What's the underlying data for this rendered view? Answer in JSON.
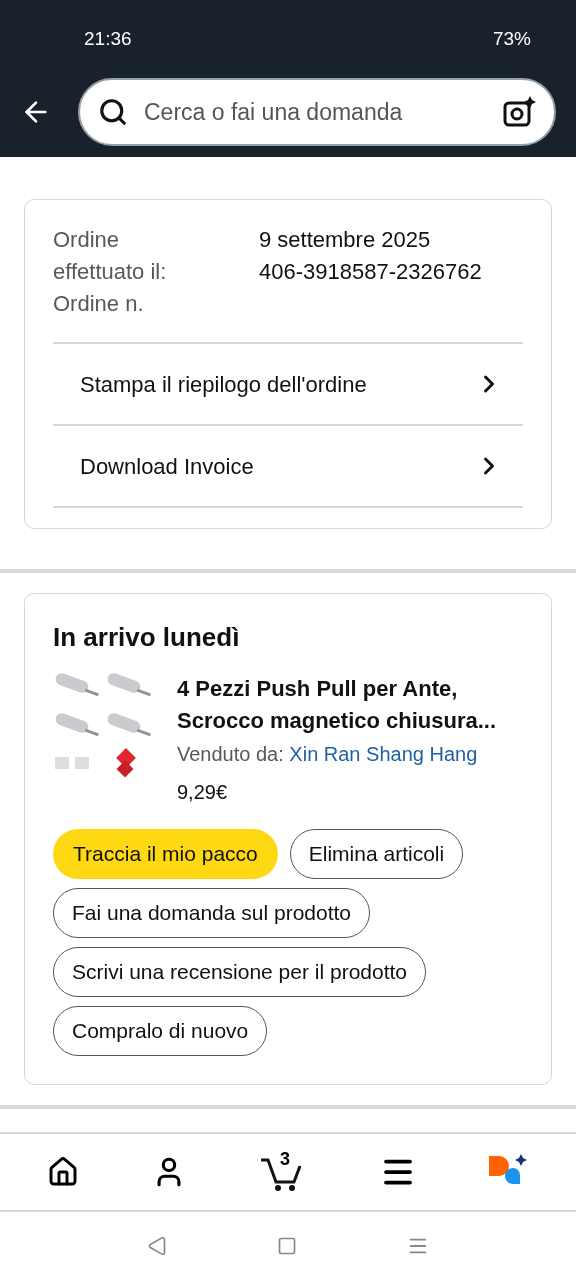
{
  "status_bar": {
    "time": "21:36",
    "battery": "73%"
  },
  "search": {
    "placeholder": "Cerca o fai una domanda"
  },
  "order_info": {
    "labels": [
      "Ordine",
      "effettuato il:",
      "Ordine n."
    ],
    "values": [
      "9 settembre 2025",
      "406-3918587-2326762"
    ]
  },
  "order_links": [
    "Stampa il riepilogo dell'ordine",
    "Download Invoice"
  ],
  "delivery": {
    "title": "In arrivo lunedì",
    "product": {
      "kind": "picture",
      "title": "4 Pezzi Push Pull per Ante, Scrocco magnetico chiusura...",
      "seller_label": "Venduto da:",
      "seller": "Xin Ran Shang Hang",
      "price": "9,29€"
    },
    "actions": [
      {
        "label": "Traccia il mio pacco",
        "kind": "primary"
      },
      {
        "label": "Elimina articoli",
        "kind": "secondary"
      },
      {
        "label": "Fai una domanda sul prodotto",
        "kind": "secondary"
      },
      {
        "label": "Scrivi una recensione per il prodotto",
        "kind": "secondary"
      },
      {
        "label": "Compralo di nuovo",
        "kind": "secondary"
      }
    ]
  },
  "bottom_nav": {
    "cart_count": "3"
  }
}
